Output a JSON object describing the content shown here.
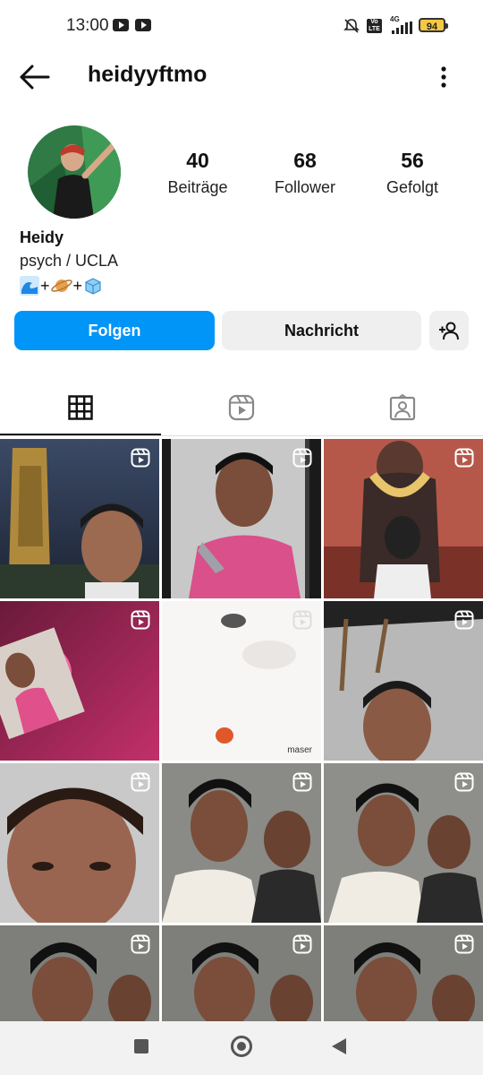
{
  "status_bar": {
    "time": "13:00",
    "network": "4G",
    "volte": "Vo LTE",
    "battery": "94"
  },
  "header": {
    "username": "heidyyftmo"
  },
  "profile": {
    "stats": [
      {
        "value": "40",
        "label": "Beiträge"
      },
      {
        "value": "68",
        "label": "Follower"
      },
      {
        "value": "56",
        "label": "Gefolgt"
      }
    ],
    "name": "Heidy",
    "bio": "psych  / UCLA",
    "bio_symbols": [
      "🌊",
      "+",
      "🪐",
      "+",
      "🧊"
    ]
  },
  "actions": {
    "follow_label": "Folgen",
    "message_label": "Nachricht"
  },
  "tabs": [
    {
      "icon": "grid-icon",
      "active": true
    },
    {
      "icon": "reels-icon",
      "active": false
    },
    {
      "icon": "tagged-icon",
      "active": false
    }
  ],
  "posts_watermark": "maser",
  "colors": {
    "accent": "#0095f6",
    "secondary_button": "#efefef",
    "battery": "#f5c842"
  }
}
